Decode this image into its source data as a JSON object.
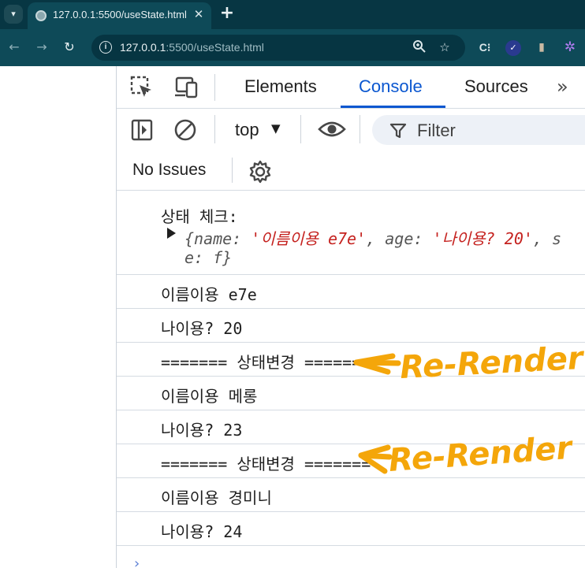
{
  "browser": {
    "tab_title": "127.0.0.1:5500/useState.html",
    "tab_close": "✕",
    "new_tab": "+",
    "url_host": "127.0.0.1",
    "url_rest": ":5500/useState.html",
    "extensions": {
      "ext1": "C⁝",
      "ext2": "✓",
      "ext3": "▮",
      "ext4": "✲"
    }
  },
  "devtools": {
    "tabs": [
      {
        "label": "Elements"
      },
      {
        "label": "Console"
      },
      {
        "label": "Sources"
      }
    ],
    "more_tabs": "»",
    "context": "top",
    "filter_label": "Filter",
    "issues_label": "No Issues"
  },
  "console": {
    "messages": [
      {
        "text": "상태 체크:",
        "object": {
          "line1_prefix": "{name: ",
          "name_value": "'이름이용 e7e'",
          "age_key": ", age: ",
          "age_value": "'나이용? 20'",
          "trail": ", s",
          "line2": "e: f}"
        }
      },
      {
        "text": "이름이용 e7e"
      },
      {
        "text": "나이용? 20"
      },
      {
        "text": "======= 상태변경 ======="
      },
      {
        "text": "이름이용 메롱"
      },
      {
        "text": "나이용? 23"
      },
      {
        "text": "======= 상태변경 ======="
      },
      {
        "text": "이름이용 경미니"
      },
      {
        "text": "나이용? 24"
      }
    ],
    "prompt": "›"
  },
  "annotations": [
    {
      "text": "Re-Render"
    },
    {
      "text": "Re-Render"
    }
  ],
  "colors": {
    "accent": "#0b57d0",
    "annotation": "#f4a60a",
    "chrome_dark": "#073643",
    "chrome": "#0e4a58"
  }
}
